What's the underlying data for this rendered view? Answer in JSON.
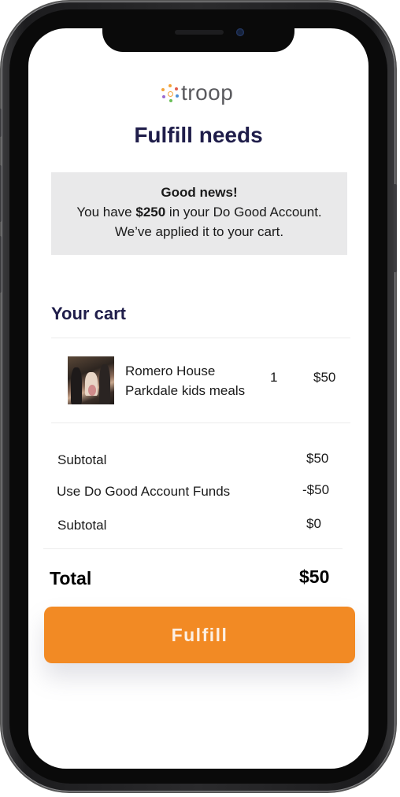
{
  "brand": {
    "name": "troop",
    "logo_colors": [
      "#f3a33a",
      "#e25b4c",
      "#4c8fd6",
      "#6bbf59",
      "#9b6bd1"
    ]
  },
  "page": {
    "title": "Fulfill needs"
  },
  "banner": {
    "heading": "Good news!",
    "line1_prefix": "You have ",
    "amount": "$250",
    "line1_suffix": " in your Do Good Account.",
    "line2": "We’ve applied it to your cart."
  },
  "cart": {
    "title": "Your cart",
    "items": [
      {
        "name_line1": "Romero House",
        "name_line2": "Parkdale kids meals",
        "quantity": "1",
        "price": "$50"
      }
    ]
  },
  "summary": {
    "rows": [
      {
        "label": "Subtotal",
        "value": "$50"
      },
      {
        "label": "Use Do Good Account Funds",
        "value": "-$50"
      },
      {
        "label": "Subtotal",
        "value": "$0"
      }
    ],
    "total_label": "Total",
    "total_value": "$50"
  },
  "actions": {
    "fulfill_label": "Fulfill",
    "accent_color": "#f28a24"
  }
}
